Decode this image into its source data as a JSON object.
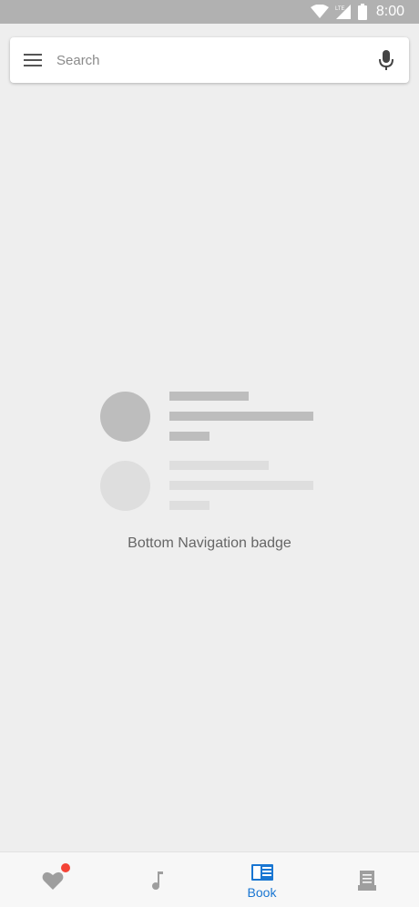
{
  "status_bar": {
    "time": "8:00",
    "network_label": "LTE",
    "icons": [
      "wifi-icon",
      "cell-signal-icon",
      "battery-icon"
    ]
  },
  "search": {
    "placeholder": "Search",
    "leading_icon": "menu-icon",
    "trailing_icon": "mic-icon"
  },
  "empty_state": {
    "caption": "Bottom Navigation badge"
  },
  "bottom_nav": {
    "items": [
      {
        "icon": "heart-icon",
        "label": "",
        "has_badge": true,
        "selected": false
      },
      {
        "icon": "music-note-icon",
        "label": "",
        "has_badge": false,
        "selected": false
      },
      {
        "icon": "book-icon",
        "label": "Book",
        "has_badge": false,
        "selected": true
      },
      {
        "icon": "newspaper-icon",
        "label": "",
        "has_badge": false,
        "selected": false
      }
    ]
  },
  "colors": {
    "status_bar": "#b1b1b1",
    "background": "#eeeeee",
    "accent": "#1976d2",
    "badge": "#f44336",
    "inactive_icon": "#9e9e9e"
  }
}
